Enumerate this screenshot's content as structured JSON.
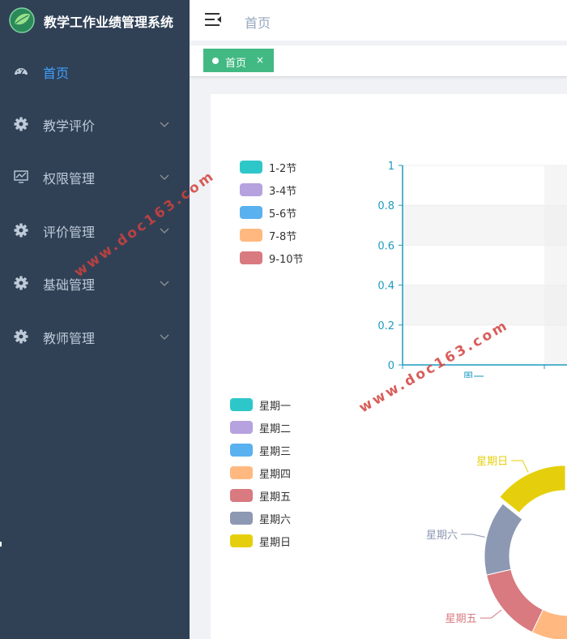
{
  "app": {
    "title": "教学工作业绩管理系统"
  },
  "sidebar": {
    "items": [
      {
        "label": "首页",
        "icon": "dashboard-icon",
        "active": true
      },
      {
        "label": "教学评价",
        "icon": "gear-icon",
        "expandable": true
      },
      {
        "label": "权限管理",
        "icon": "monitor-chart-icon",
        "expandable": true
      },
      {
        "label": "评价管理",
        "icon": "gear-icon",
        "expandable": true
      },
      {
        "label": "基础管理",
        "icon": "gear-icon",
        "expandable": true
      },
      {
        "label": "教师管理",
        "icon": "gear-icon",
        "expandable": true
      }
    ]
  },
  "header": {
    "breadcrumb": "首页"
  },
  "tags": [
    {
      "label": "首页",
      "close": "×",
      "active": true
    }
  ],
  "watermark": "www.doc163.com",
  "colors": {
    "sidebar_bg": "#304156",
    "active_text": "#409eff",
    "tag_bg": "#42b983",
    "axis": "#1e9bbf",
    "palette": [
      "#2ec7c9",
      "#b6a2de",
      "#5ab1ef",
      "#ffb980",
      "#d87a80",
      "#8d98b3",
      "#e5cf0d"
    ]
  },
  "chart_data": [
    {
      "type": "bar",
      "legend": [
        "1-2节",
        "3-4节",
        "5-6节",
        "7-8节",
        "9-10节"
      ],
      "legend_position": "left",
      "categories": [
        "周一"
      ],
      "series": [
        {
          "name": "1-2节",
          "values": [
            0
          ]
        },
        {
          "name": "3-4节",
          "values": [
            0
          ]
        },
        {
          "name": "5-6节",
          "values": [
            0
          ]
        },
        {
          "name": "7-8节",
          "values": [
            0
          ]
        },
        {
          "name": "9-10节",
          "values": [
            0
          ]
        }
      ],
      "y_ticks": [
        "0",
        "0.2",
        "0.4",
        "0.6",
        "0.8",
        "1"
      ],
      "ylim": [
        0,
        1
      ],
      "split_area": true
    },
    {
      "type": "pie",
      "donut": true,
      "legend": [
        "星期一",
        "星期二",
        "星期三",
        "星期四",
        "星期五",
        "星期六",
        "星期日"
      ],
      "legend_position": "left",
      "slices": [
        {
          "name": "星期一",
          "value": 1
        },
        {
          "name": "星期二",
          "value": 1
        },
        {
          "name": "星期三",
          "value": 1
        },
        {
          "name": "星期四",
          "value": 1
        },
        {
          "name": "星期五",
          "value": 1
        },
        {
          "name": "星期六",
          "value": 1
        },
        {
          "name": "星期日",
          "value": 1,
          "highlighted": true
        }
      ]
    }
  ]
}
